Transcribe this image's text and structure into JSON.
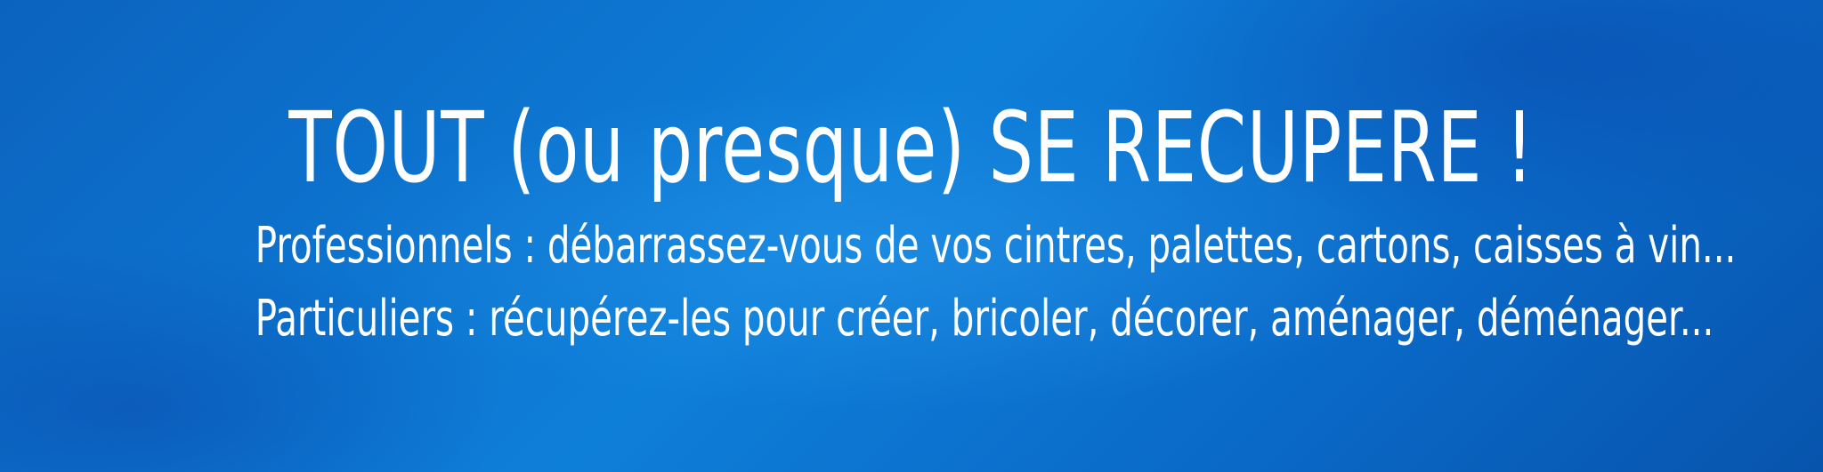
{
  "banner": {
    "headline": "TOUT (ou presque) SE RECUPERE !",
    "line_professionals": "Professionnels : débarrassez-vous de vos cintres, palettes, cartons, caisses à vin...",
    "line_individuals": "Particuliers : récupérez-les pour créer, bricoler, décorer, aménager, déménager...",
    "colors": {
      "background": "#0a68c6",
      "text": "#ffffff"
    }
  }
}
